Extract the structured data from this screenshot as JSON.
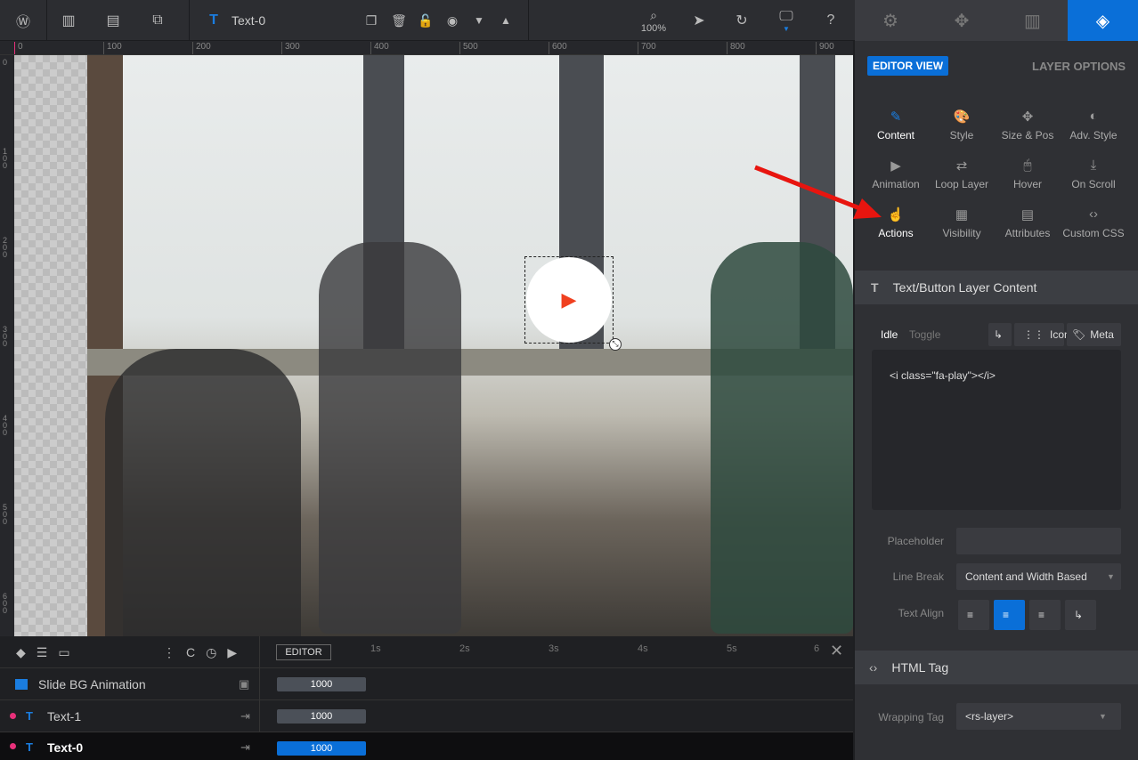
{
  "topbar": {
    "layer_name": "Text-0",
    "zoom": "100%"
  },
  "ruler": {
    "h": [
      "0",
      "100",
      "200",
      "300",
      "400",
      "500",
      "600",
      "700",
      "800",
      "900"
    ],
    "v": [
      "0",
      "100",
      "200",
      "300",
      "400",
      "500",
      "600"
    ]
  },
  "panel": {
    "editor_view": "EDITOR VIEW",
    "layer_options": "LAYER OPTIONS",
    "options": [
      {
        "label": "Content",
        "icon": "✎"
      },
      {
        "label": "Style",
        "icon": "🎨"
      },
      {
        "label": "Size & Pos",
        "icon": "✥"
      },
      {
        "label": "Adv. Style",
        "icon": "◐"
      },
      {
        "label": "Animation",
        "icon": "▶"
      },
      {
        "label": "Loop Layer",
        "icon": "⇄"
      },
      {
        "label": "Hover",
        "icon": "🖱"
      },
      {
        "label": "On Scroll",
        "icon": "⤓"
      },
      {
        "label": "Actions",
        "icon": "☝"
      },
      {
        "label": "Visibility",
        "icon": "▦"
      },
      {
        "label": "Attributes",
        "icon": "▤"
      },
      {
        "label": "Custom CSS",
        "icon": "‹›"
      }
    ],
    "content_section": "Text/Button Layer Content",
    "idle": "Idle",
    "toggle": "Toggle",
    "icon_btn": "Icon",
    "meta_btn": "Meta",
    "content_text": "<i class=\"fa-play\"></i>",
    "placeholder_label": "Placeholder",
    "placeholder_value": "",
    "line_break_label": "Line Break",
    "line_break_value": "Content and Width Based",
    "text_align_label": "Text Align",
    "html_tag_section": "HTML Tag",
    "wrapping_tag_label": "Wrapping Tag",
    "wrapping_tag_value": "<rs-layer>"
  },
  "timeline": {
    "editor": "EDITOR",
    "ticks": [
      "1s",
      "2s",
      "3s",
      "4s",
      "5s",
      "6"
    ],
    "rows": [
      {
        "name": "Slide BG Animation",
        "duration": "1000"
      },
      {
        "name": "Text-1",
        "duration": "1000"
      },
      {
        "name": "Text-0",
        "duration": "1000"
      }
    ]
  },
  "colors": {
    "accent": "#0a6fd8",
    "marker": "#e8307a",
    "play": "#f0401f"
  }
}
